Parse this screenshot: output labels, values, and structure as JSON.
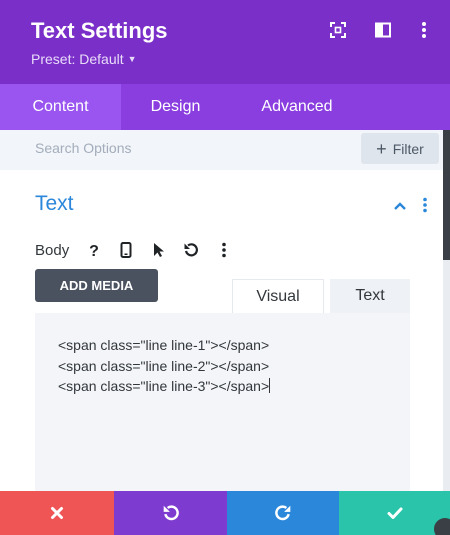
{
  "header": {
    "title": "Text Settings",
    "preset": "Preset: Default",
    "icons": [
      "focus-icon",
      "sidebar-layout-icon",
      "more-vertical-icon"
    ]
  },
  "tabs": [
    {
      "label": "Content",
      "active": true
    },
    {
      "label": "Design",
      "active": false
    },
    {
      "label": "Advanced",
      "active": false
    }
  ],
  "search": {
    "placeholder": "Search Options",
    "filter_label": "Filter"
  },
  "section": {
    "title": "Text"
  },
  "field": {
    "label": "Body",
    "icons": [
      "help-icon",
      "mobile-icon",
      "cursor-icon",
      "undo-icon",
      "more-vertical-icon"
    ]
  },
  "editor": {
    "add_media_label": "ADD MEDIA",
    "tabs": [
      {
        "label": "Visual",
        "active": false
      },
      {
        "label": "Text",
        "active": true
      }
    ],
    "lines": [
      "<span class=\"line line-1\"></span>",
      "<span class=\"line line-2\"></span>",
      "<span class=\"line line-3\"></span>"
    ]
  },
  "footer": {
    "buttons": [
      {
        "icon": "close-icon",
        "color": "#ef5555"
      },
      {
        "icon": "undo-icon",
        "color": "#7e3bd0"
      },
      {
        "icon": "redo-icon",
        "color": "#2b87da"
      },
      {
        "icon": "checkmark-icon",
        "color": "#29c4a9"
      }
    ]
  },
  "colors": {
    "header_bg": "#7b2fc9",
    "tabs_bg": "#8a3ee0",
    "active_tab_bg": "#9a55f0",
    "accent_blue": "#2b87da"
  }
}
